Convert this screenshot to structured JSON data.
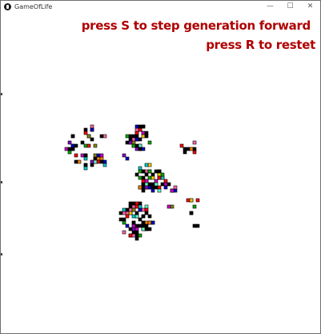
{
  "window": {
    "title": "GameOfLife",
    "controls": {
      "minimize": "—",
      "maximize": "☐",
      "close": "✕"
    }
  },
  "instructions": {
    "step": "press S to step generation forward",
    "reset": "press R to restet",
    "color": "#b00000"
  },
  "board": {
    "palette": [
      "#ff0000",
      "#00aa00",
      "#0000cc",
      "#cc00cc",
      "#00cccc",
      "#ffcc00",
      "#ff8800",
      "#000000",
      "#888800",
      "#66ffcc",
      "#ff66aa",
      "#8800cc"
    ],
    "cell_outline": "#000000",
    "background": "#ffffff"
  }
}
